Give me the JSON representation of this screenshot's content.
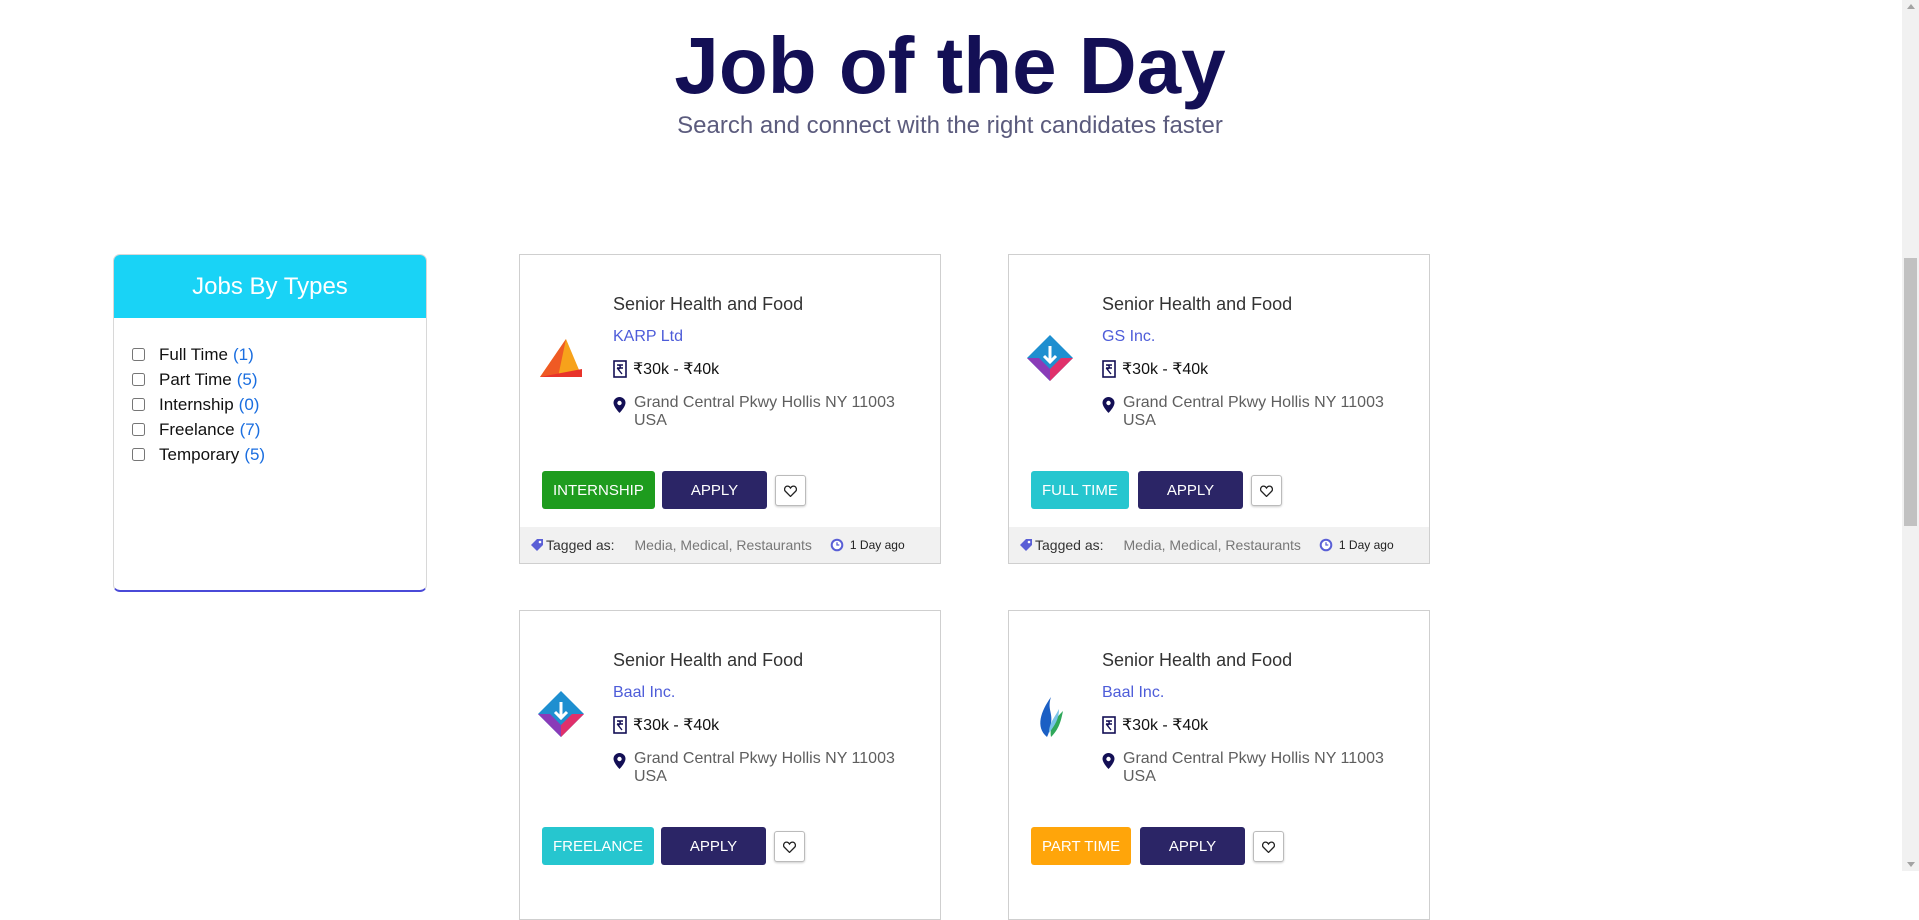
{
  "hero": {
    "title": "Job of the Day",
    "subtitle": "Search and connect with the right candidates faster"
  },
  "filter": {
    "heading": "Jobs By Types",
    "items": [
      {
        "label": "Full Time",
        "count": "(1)"
      },
      {
        "label": "Part Time",
        "count": "(5)"
      },
      {
        "label": "Internship",
        "count": "(0)"
      },
      {
        "label": "Freelance",
        "count": "(7)"
      },
      {
        "label": "Temporary",
        "count": "(5)"
      }
    ]
  },
  "jobs": [
    {
      "title": "Senior Health and Food",
      "company": "KARP Ltd",
      "salary": "₹30k - ₹40k",
      "location": "Grand Central Pkwy Hollis NY 11003 USA",
      "type": "INTERNSHIP",
      "type_color": "#1e9c1e",
      "apply": "APPLY",
      "tagged_label": "Tagged as:",
      "tags": "Media, Medical, Restaurants",
      "posted": "1 Day ago",
      "logo": "orange-fold-logo"
    },
    {
      "title": "Senior Health and Food",
      "company": "GS Inc.",
      "salary": "₹30k - ₹40k",
      "location": "Grand Central Pkwy Hollis NY 11003 USA",
      "type": "FULL TIME",
      "type_color": "#26c6cf",
      "apply": "APPLY",
      "tagged_label": "Tagged as:",
      "tags": "Media, Medical, Restaurants",
      "posted": "1 Day ago",
      "logo": "diamond-logo"
    },
    {
      "title": "Senior Health and Food",
      "company": "Baal Inc.",
      "salary": "₹30k - ₹40k",
      "location": "Grand Central Pkwy Hollis NY 11003 USA",
      "type": "FREELANCE",
      "type_color": "#26c6cf",
      "apply": "APPLY",
      "logo": "diamond-logo"
    },
    {
      "title": "Senior Health and Food",
      "company": "Baal Inc.",
      "salary": "₹30k - ₹40k",
      "location": "Grand Central Pkwy Hollis NY 11003 USA",
      "type": "PART TIME",
      "type_color": "#ffa50a",
      "apply": "APPLY",
      "logo": "flame-logo"
    }
  ],
  "colors": {
    "accent": "#19d3f6",
    "navy": "#130f55",
    "apply": "#2b2566",
    "link": "#4d5cd9"
  }
}
